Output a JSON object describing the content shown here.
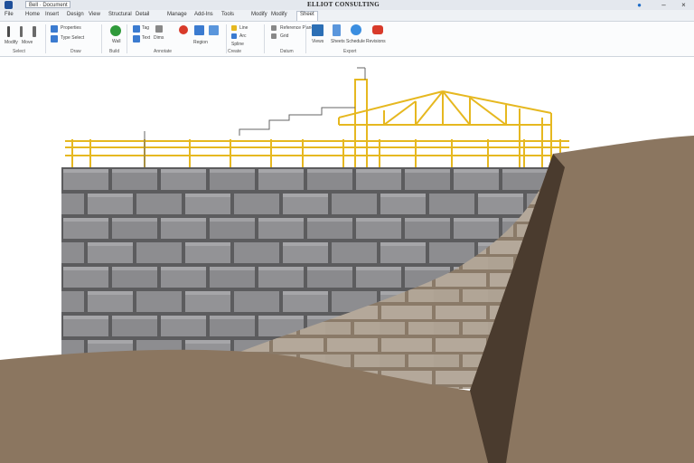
{
  "window": {
    "title": "ELLIOT CONSULTING",
    "document_label": "Bell · Document"
  },
  "tabs": [
    "File",
    "Home",
    "Insert",
    "Design",
    "View",
    "Structural",
    "Detail",
    "Manage",
    "Add-Ins",
    "Tools",
    "Modify",
    "Sheet"
  ],
  "active_tab": "Sheet",
  "ribbon": {
    "groups": [
      {
        "label": "Select",
        "items": [
          "Modify",
          "Move",
          "Align"
        ]
      },
      {
        "label": "Draw",
        "items": [
          "Properties",
          "Type Select"
        ]
      },
      {
        "label": "Build",
        "items": [
          "Wall"
        ]
      },
      {
        "label": "Annotate",
        "items": [
          "Tag",
          "Text",
          "Dims",
          "Detail",
          "Region"
        ]
      },
      {
        "label": "Create",
        "items": [
          "Line",
          "Arc",
          "Spline"
        ]
      },
      {
        "label": "Datum",
        "items": [
          "Reference Plane",
          "Grid",
          "Level"
        ]
      },
      {
        "label": "Export",
        "items": [
          "Views",
          "Sheets",
          "Schedule",
          "Revisions"
        ]
      }
    ]
  },
  "colors": {
    "wall": "#8e8e90",
    "mortar": "#5a5a5c",
    "soil": "#8b7660",
    "soil_dark": "#4a3b2e",
    "steel": "#e6b820",
    "ribbon_bg": "#fbfcfd"
  },
  "icons": [
    "app-icon",
    "help-icon",
    "minimize-icon",
    "close-icon"
  ]
}
